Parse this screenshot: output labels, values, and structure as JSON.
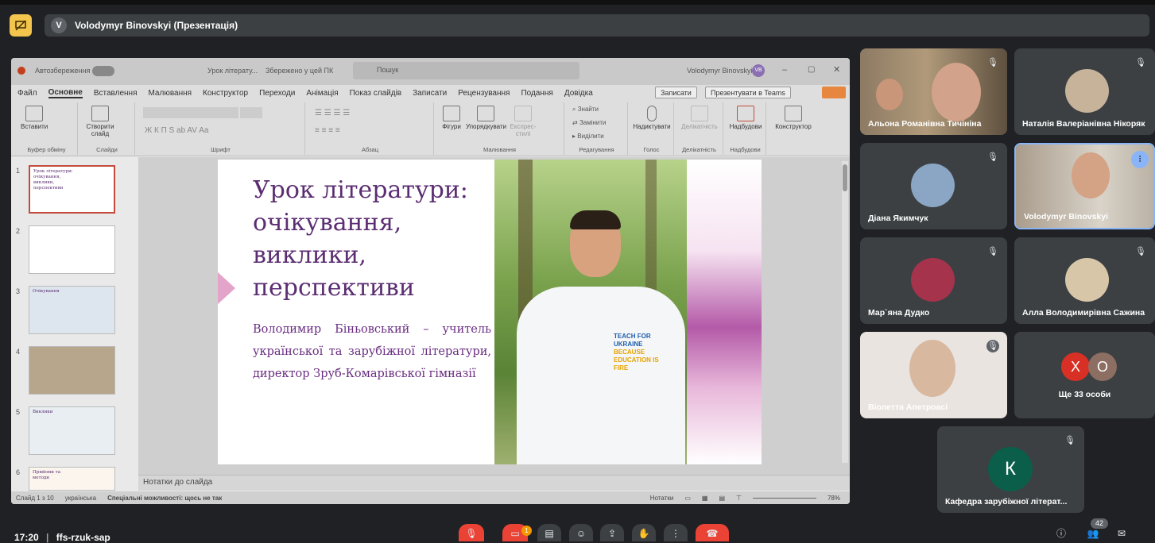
{
  "meet": {
    "presenter_initial": "V",
    "presenter_title": "Volodymyr Binovskyi (Презентація)",
    "time": "17:20",
    "separator": "|",
    "meeting_code": "ffs-rzuk-sap",
    "participant_count": "42",
    "raised_badge": "1"
  },
  "ppt": {
    "autosave_label": "Автозбереження",
    "doc_title": "Урок літерату...",
    "saved_state": "Збережено у цей ПК",
    "search_placeholder": "Пошук",
    "user_name": "Volodymyr Binovskyi",
    "user_initials": "VB",
    "menu": [
      "Файл",
      "Основне",
      "Вставлення",
      "Малювання",
      "Конструктор",
      "Переходи",
      "Анімація",
      "Показ слайдів",
      "Записати",
      "Рецензування",
      "Подання",
      "Довідка"
    ],
    "record_button": "Записати",
    "teams_button": "Презентувати в Teams",
    "ribbon": {
      "paste": "Вставити",
      "clipboard": "Буфер обміну",
      "new_slide": "Створити слайд",
      "slides": "Слайди",
      "font": "Шрифт",
      "paragraph": "Абзац",
      "shapes": "Фігури",
      "arrange": "Упорядкувати",
      "quick_styles": "Експрес-стилі",
      "drawing": "Малювання",
      "find": "Знайти",
      "replace": "Замінити",
      "select": "Виділити",
      "editing": "Редагування",
      "dictate": "Надиктувати",
      "voice": "Голос",
      "sensitivity": "Делікатність",
      "addins": "Надбудови",
      "designer": "Конструктор"
    },
    "thumb_numbers": [
      "1",
      "2",
      "3",
      "4",
      "5",
      "6"
    ],
    "thumb_mini_titles": [
      "Урок літератури: очікування, виклики, перспективи",
      "",
      "Очікування",
      "",
      "Виклики",
      "Прийоми та методи"
    ],
    "slide": {
      "title": "Урок літератури: очікування, виклики, перспективи",
      "subtitle": "Володимир Біньовський – учитель української та зарубіжної літератури, директор Зруб-Комарівської гімназії",
      "shirt_line1": "TEACH FOR UKRAINE",
      "shirt_line2": "BECAUSE EDUCATION IS FIRE"
    },
    "notes_placeholder": "Нотатки до слайда",
    "status": {
      "slide_of": "Слайд 1 з 10",
      "language": "українська",
      "accessibility": "Спеціальні можливості: щось не так",
      "notes": "Нотатки",
      "zoom": "78%"
    }
  },
  "participants": [
    {
      "name": "Альона Романівна Тичініна"
    },
    {
      "name": "Наталія Валеріанівна Нікоряк"
    },
    {
      "name": "Діана Якимчук"
    },
    {
      "name": "Volodymyr Binovskyi"
    },
    {
      "name": "Мар`яна Дудко"
    },
    {
      "name": "Алла Володимирівна Сажина"
    },
    {
      "name": "Віолетта Апетроасі"
    },
    {
      "name": "Ще 33 особи",
      "initials": [
        "Х",
        "О"
      ]
    },
    {
      "name": "Кафедра зарубіжної літерат...",
      "initial": "К"
    }
  ],
  "colors": {
    "meet_bg": "#202124",
    "accent_yellow": "#f4c54c",
    "slide_purple": "#5b2d72",
    "end_call_red": "#ea4335",
    "speaking_blue": "#8ab4f8"
  }
}
